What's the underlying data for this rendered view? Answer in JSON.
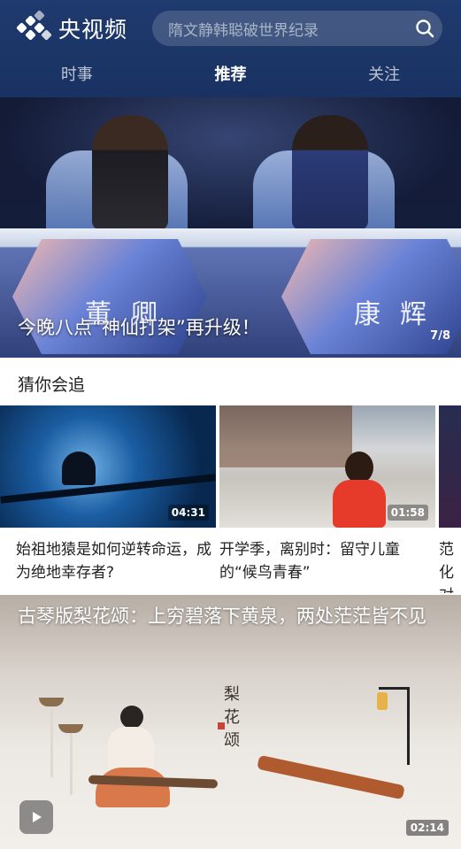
{
  "header": {
    "app_name": "央视频",
    "search_placeholder": "隋文静韩聪破世界纪录",
    "tabs": [
      {
        "label": "时事",
        "active": false
      },
      {
        "label": "推荐",
        "active": true
      },
      {
        "label": "关注",
        "active": false
      }
    ]
  },
  "hero": {
    "caption": "今晚八点“神仙打架”再升级！",
    "counter": "7/8",
    "name_left": "董卿",
    "name_right": "康辉"
  },
  "section": {
    "title": "猜你会追",
    "cards": [
      {
        "title": "始祖地猿是如何逆转命运，成为绝地幸存者?",
        "duration": "04:31"
      },
      {
        "title": "开学季，离别时：留守儿童的“候鸟青春”",
        "duration": "01:58"
      },
      {
        "title": "范化对不",
        "duration": ""
      }
    ]
  },
  "feature": {
    "title": "古琴版梨花颂：上穷碧落下黄泉，两处茫茫皆不见",
    "calligraphy": "梨花颂",
    "duration": "02:14"
  },
  "colors": {
    "header_bg": "#1f3a6e",
    "accent_white": "#ffffff",
    "text_dark": "#222222"
  }
}
